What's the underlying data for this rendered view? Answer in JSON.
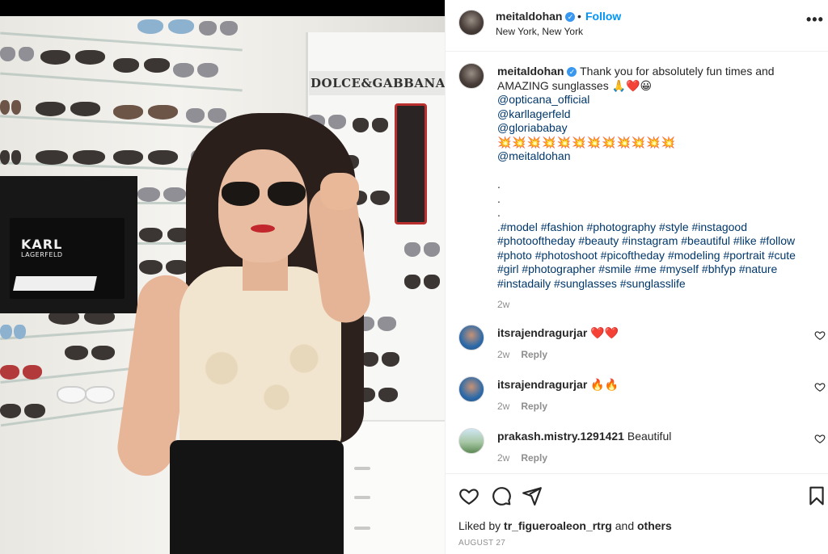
{
  "post": {
    "username": "meitaldohan",
    "verified_glyph": "✓",
    "dot": "•",
    "follow_label": "Follow",
    "location": "New York, New York",
    "more_glyph": "•••"
  },
  "photo": {
    "description_icon": "post-photo",
    "brand_sign": "DOLCE&GABBANA",
    "karl_logo_top": "KARL",
    "karl_logo_bottom": "LAGERFELD"
  },
  "caption": {
    "username": "meitaldohan",
    "line1": "Thank you for absolutely fun times and",
    "line2": "AMAZING sunglasses",
    "line2_emojis": "🙏❤️😀",
    "mentions": [
      "@opticana_official",
      "@karllagerfeld",
      "@gloriababay"
    ],
    "boom_row": "💥💥💥💥💥💥💥💥💥💥💥💥",
    "self_mention": "@meitaldohan",
    "dots": [
      ".",
      ".",
      "."
    ],
    "hashtag_lines": [
      ".#model #fashion #photography #style #instagood",
      "#photooftheday #beauty #instagram #beautiful #like #follow",
      "#photo #photoshoot #picoftheday #modeling #portrait #cute",
      "#girl #photographer #smile #me #myself #bhfyp #nature",
      "#instadaily #sunglasses #sunglasslife"
    ],
    "time": "2w"
  },
  "comments": [
    {
      "username": "itsrajendragurjar",
      "text": "❤️❤️",
      "time": "2w",
      "reply_label": "Reply"
    },
    {
      "username": "itsrajendragurjar",
      "text": "🔥🔥",
      "time": "2w",
      "reply_label": "Reply"
    },
    {
      "username": "prakash.mistry.1291421",
      "text": "Beautiful",
      "time": "2w",
      "reply_label": "Reply"
    }
  ],
  "footer": {
    "liked_by_prefix": "Liked by",
    "liked_by_user": "tr_figueroaleon_rtrg",
    "and": "and",
    "others": "others",
    "date": "AUGUST 27"
  },
  "colors": {
    "link": "#00376b",
    "follow": "#0095f6",
    "verified": "#3897f0",
    "muted": "#8e8e8e",
    "text": "#262626"
  }
}
